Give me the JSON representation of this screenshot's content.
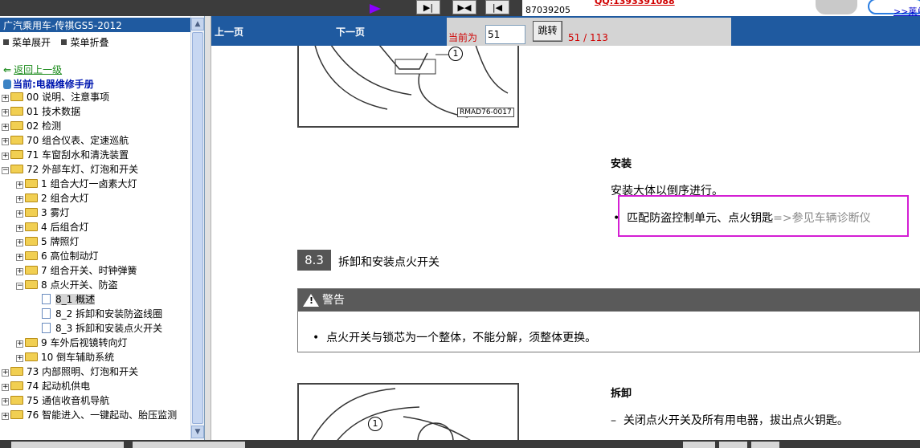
{
  "topbar": {
    "phone": "87039205",
    "qq": "QQ:1393391088",
    "more_link": ">>莱单"
  },
  "sidebar": {
    "title": "广汽乘用车-传祺GS5-2012",
    "expand_all": "菜单展开",
    "collapse_all": "菜单折叠",
    "back": "返回上一级",
    "current": "当前:电器维修手册",
    "tree": [
      {
        "label": "00 说明、注意事项"
      },
      {
        "label": "01 技术数据"
      },
      {
        "label": "02 检测"
      },
      {
        "label": "70 组合仪表、定速巡航"
      },
      {
        "label": "71 车窗刮水和清洗装置"
      },
      {
        "label": "72 外部车灯、灯泡和开关"
      },
      {
        "label": "1 组合大灯一卤素大灯"
      },
      {
        "label": "2 组合大灯"
      },
      {
        "label": "3 雾灯"
      },
      {
        "label": "4 后组合灯"
      },
      {
        "label": "5 牌照灯"
      },
      {
        "label": "6 高位制动灯"
      },
      {
        "label": "7 组合开关、时钟弹簧"
      },
      {
        "label": "8 点火开关、防盗"
      },
      {
        "label": "8_1 概述"
      },
      {
        "label": "8_2 拆卸和安装防盗线圈"
      },
      {
        "label": "8_3 拆卸和安装点火开关"
      },
      {
        "label": "9 车外后视镜转向灯"
      },
      {
        "label": "10 倒车辅助系统"
      },
      {
        "label": "73 内部照明、灯泡和开关"
      },
      {
        "label": "74 起动机供电"
      },
      {
        "label": "75 通信收音机导航"
      },
      {
        "label": "76 智能进入、一键起动、胎压监测"
      }
    ]
  },
  "nav": {
    "prev": "上一页",
    "next": "下一页",
    "current_label": "当前为",
    "page_input": "51",
    "jump": "跳转",
    "pages": "51 / 113"
  },
  "content": {
    "fig1_callout": "1",
    "fig1_code": "RMAD76-0017",
    "install_heading": "安装",
    "install_text": "安装大体以倒序进行。",
    "bullet_main": "匹配防盗控制单元、点火钥匙",
    "bullet_ref": "=>参见车辆诊断仪",
    "section_num": "8.3",
    "section_title": "拆卸和安装点火开关",
    "warning_title": "警告",
    "warning_text": "点火开关与锁芯为一个整体，不能分解，须整体更换。",
    "fig2_callout": "1",
    "remove_heading": "拆卸",
    "remove_step1": "关闭点火开关及所有用电器，拔出点火钥匙。"
  }
}
